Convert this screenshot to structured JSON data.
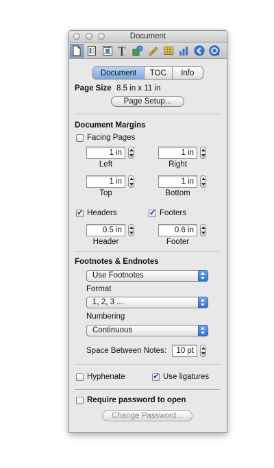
{
  "window": {
    "title": "Document"
  },
  "toolbar": {
    "icons": [
      "document-icon",
      "layout-icon",
      "wrap-icon",
      "text-icon",
      "shapes-icon",
      "ruler-icon",
      "table-icon",
      "chart-icon",
      "hyperlink-icon",
      "quicktime-icon"
    ],
    "selected_index": 0
  },
  "tabs": [
    {
      "label": "Document",
      "selected": true
    },
    {
      "label": "TOC",
      "selected": false
    },
    {
      "label": "Info",
      "selected": false
    }
  ],
  "page_size": {
    "label": "Page Size",
    "value": "8.5 in x 11 in",
    "button": "Page Setup..."
  },
  "margins": {
    "heading": "Document Margins",
    "facing_pages": {
      "label": "Facing Pages",
      "checked": false
    },
    "left": {
      "value": "1 in",
      "label": "Left"
    },
    "right": {
      "value": "1 in",
      "label": "Right"
    },
    "top": {
      "value": "1 in",
      "label": "Top"
    },
    "bottom": {
      "value": "1 in",
      "label": "Bottom"
    },
    "headers": {
      "label": "Headers",
      "checked": true
    },
    "footers": {
      "label": "Footers",
      "checked": true
    },
    "header": {
      "value": "0.5 in",
      "label": "Header"
    },
    "footer": {
      "value": "0.6 in",
      "label": "Footer"
    }
  },
  "footnotes": {
    "heading": "Footnotes & Endnotes",
    "type_value": "Use Footnotes",
    "format_label": "Format",
    "format_value": "1, 2, 3 ...",
    "numbering_label": "Numbering",
    "numbering_value": "Continuous",
    "space_label": "Space Between Notes:",
    "space_value": "10 pt"
  },
  "options": {
    "hyphenate": {
      "label": "Hyphenate",
      "checked": false
    },
    "ligatures": {
      "label": "Use ligatures",
      "checked": true
    }
  },
  "password": {
    "require": {
      "label": "Require password to open",
      "checked": false
    },
    "button": "Change Password..."
  },
  "colors": {
    "accent": "#3b7be0",
    "selected_tab": "#8db5e8"
  }
}
